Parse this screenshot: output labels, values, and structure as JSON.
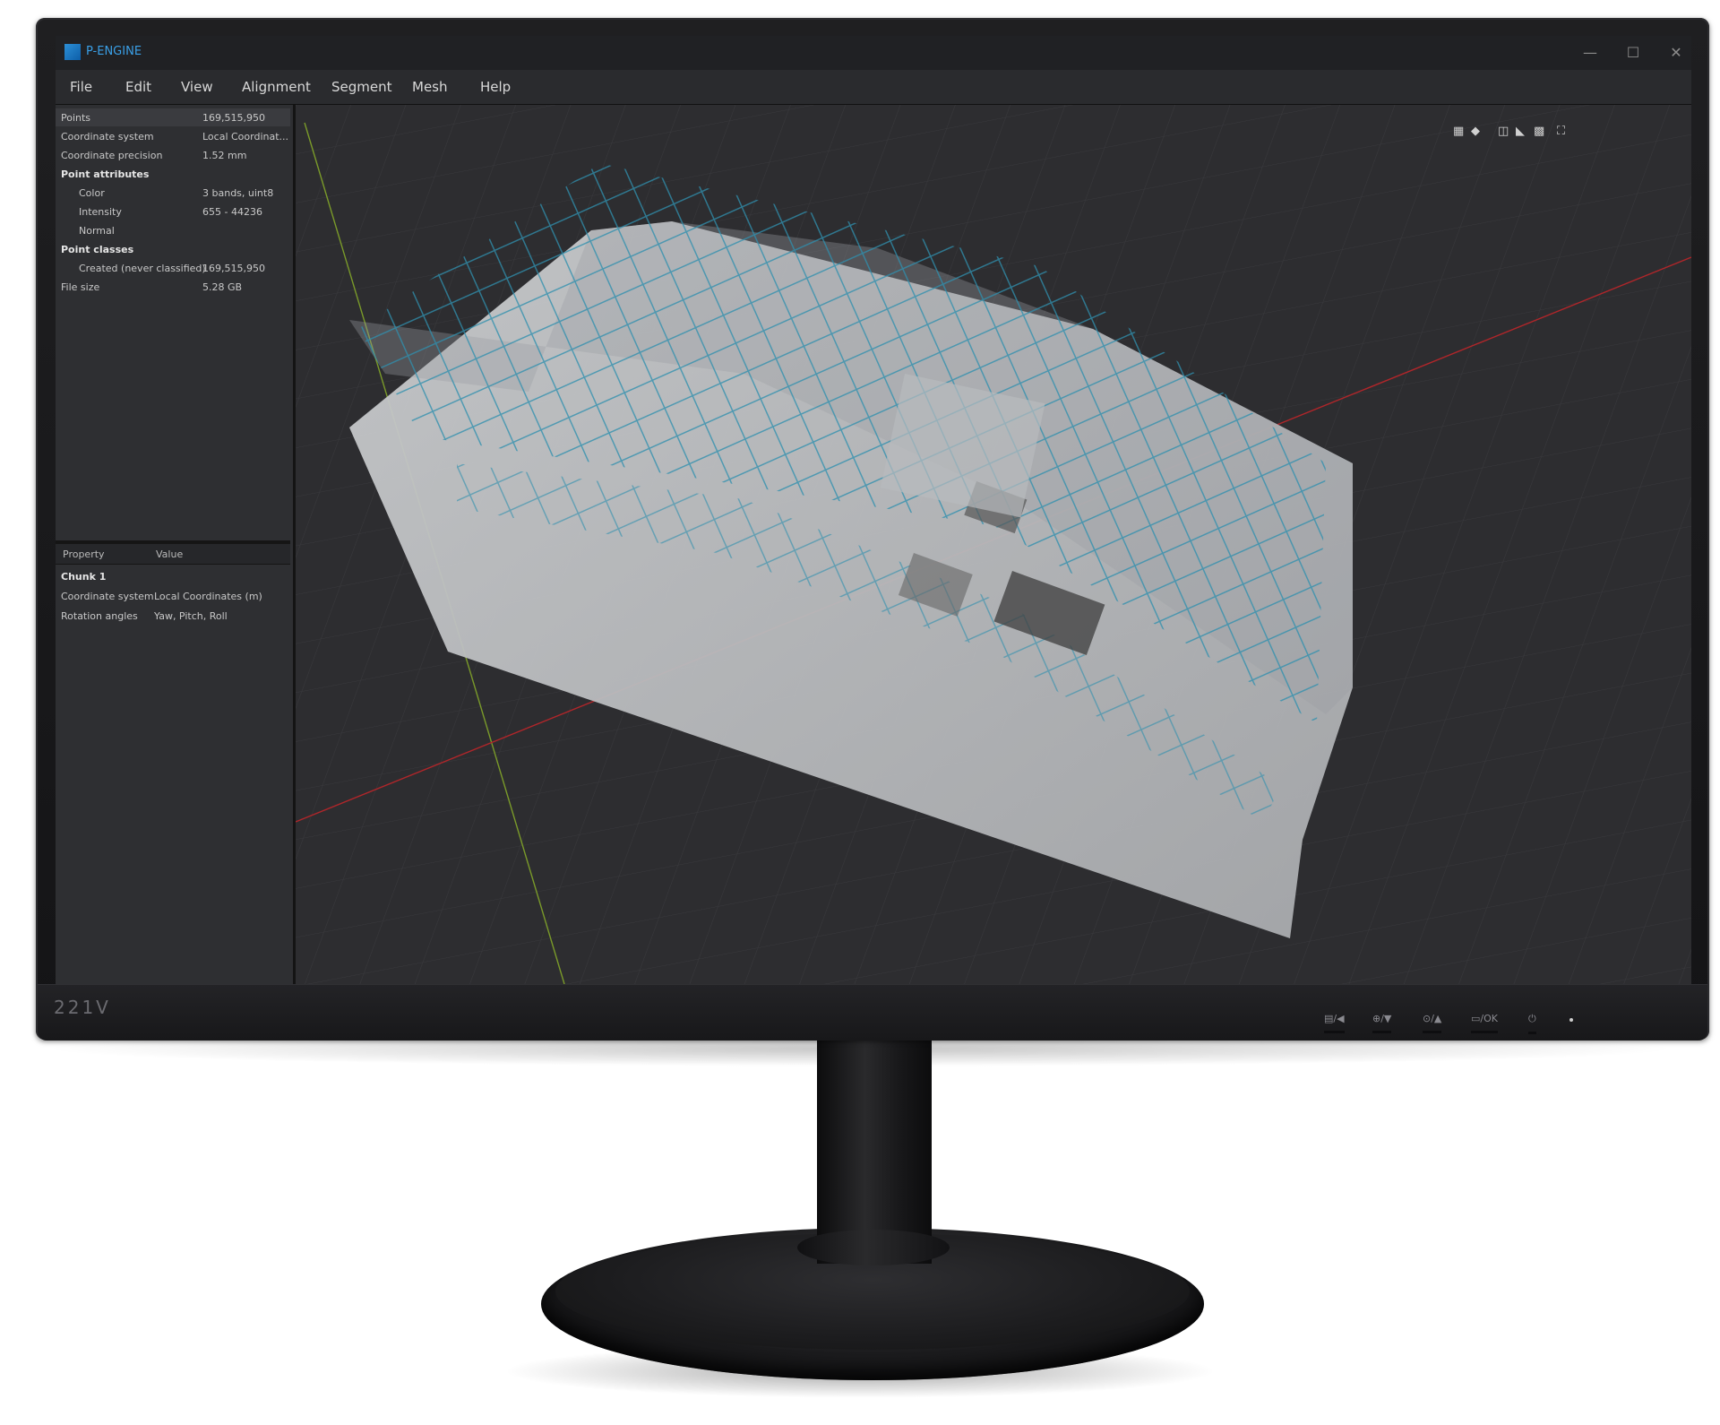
{
  "app": {
    "title": "P-ENGINE",
    "window_controls": [
      "—",
      "☐",
      "✕"
    ]
  },
  "menu": [
    "File",
    "Edit",
    "View",
    "Alignment",
    "Segment",
    "Mesh",
    "Help"
  ],
  "info_panel": {
    "rows": [
      {
        "key": "Points",
        "value": "169,515,950",
        "indent": 0,
        "bold": false
      },
      {
        "key": "Coordinate system",
        "value": "Local Coordinat...",
        "indent": 0,
        "bold": false
      },
      {
        "key": "Coordinate precision",
        "value": "1.52 mm",
        "indent": 0,
        "bold": false
      },
      {
        "key": "Point attributes",
        "value": "",
        "indent": 0,
        "bold": true
      },
      {
        "key": "Color",
        "value": "3 bands, uint8",
        "indent": 1,
        "bold": false
      },
      {
        "key": "Intensity",
        "value": "655 - 44236",
        "indent": 1,
        "bold": false
      },
      {
        "key": "Normal",
        "value": "",
        "indent": 1,
        "bold": false
      },
      {
        "key": "Point classes",
        "value": "",
        "indent": 0,
        "bold": true
      },
      {
        "key": "Created (never classified)",
        "value": "169,515,950",
        "indent": 1,
        "bold": false
      },
      {
        "key": "File size",
        "value": "5.28 GB",
        "indent": 0,
        "bold": false
      }
    ]
  },
  "property_panel": {
    "headers": [
      "Property",
      "Value"
    ],
    "group": "Chunk 1",
    "rows": [
      {
        "key": "Coordinate system",
        "value": "Local Coordinates (m)"
      },
      {
        "key": "Rotation angles",
        "value": "Yaw, Pitch, Roll"
      }
    ]
  },
  "viewport_toolbar": [
    "grid-icon",
    "cube-icon",
    "split-icon",
    "tag-icon",
    "layers-icon",
    "focus-icon"
  ],
  "monitor": {
    "model": "221V",
    "osd_buttons": [
      "▤/◀",
      "⊕/▼",
      "⊙/▲",
      "▭/OK",
      "⏻"
    ]
  },
  "colors": {
    "accent": "#3aa0e8",
    "point_cloud": "#2f8fae",
    "axis_x": "#b0262a",
    "axis_y": "#7a9a2a"
  }
}
